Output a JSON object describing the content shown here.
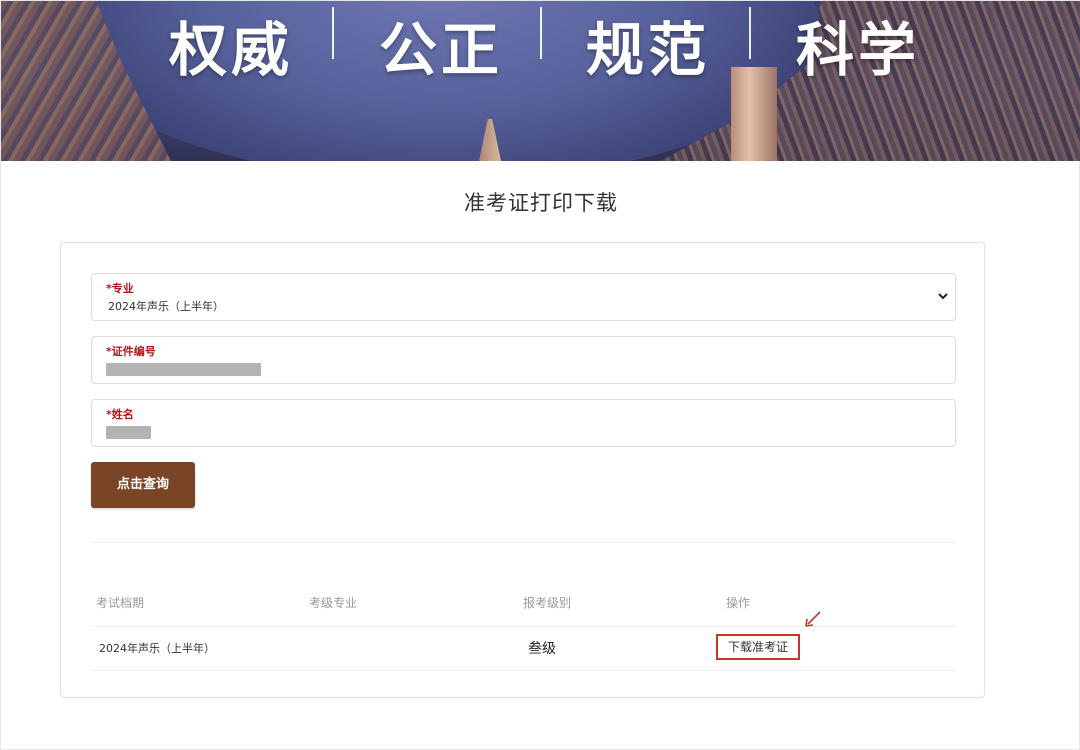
{
  "banner": {
    "slogans": [
      "权威",
      "公正",
      "规范",
      "科学"
    ]
  },
  "page": {
    "title": "准考证打印下载"
  },
  "form": {
    "major": {
      "label": "*专业",
      "value": "2024年声乐（上半年）"
    },
    "id_number": {
      "label": "*证件编号"
    },
    "name": {
      "label": "*姓名"
    },
    "query_button": "点击查询"
  },
  "table": {
    "headers": [
      "考试档期",
      "考级专业",
      "报考级别",
      "操作"
    ],
    "rows": [
      {
        "period": "2024年声乐（上半年）",
        "major": "",
        "level": "叁级",
        "action": "下载准考证"
      }
    ]
  },
  "colors": {
    "accent": "#7b4427",
    "required": "#b01818",
    "highlight": "#c0392b"
  },
  "icons": {
    "select_caret": "chevron-down-icon",
    "annotation": "red-arrow-icon"
  }
}
